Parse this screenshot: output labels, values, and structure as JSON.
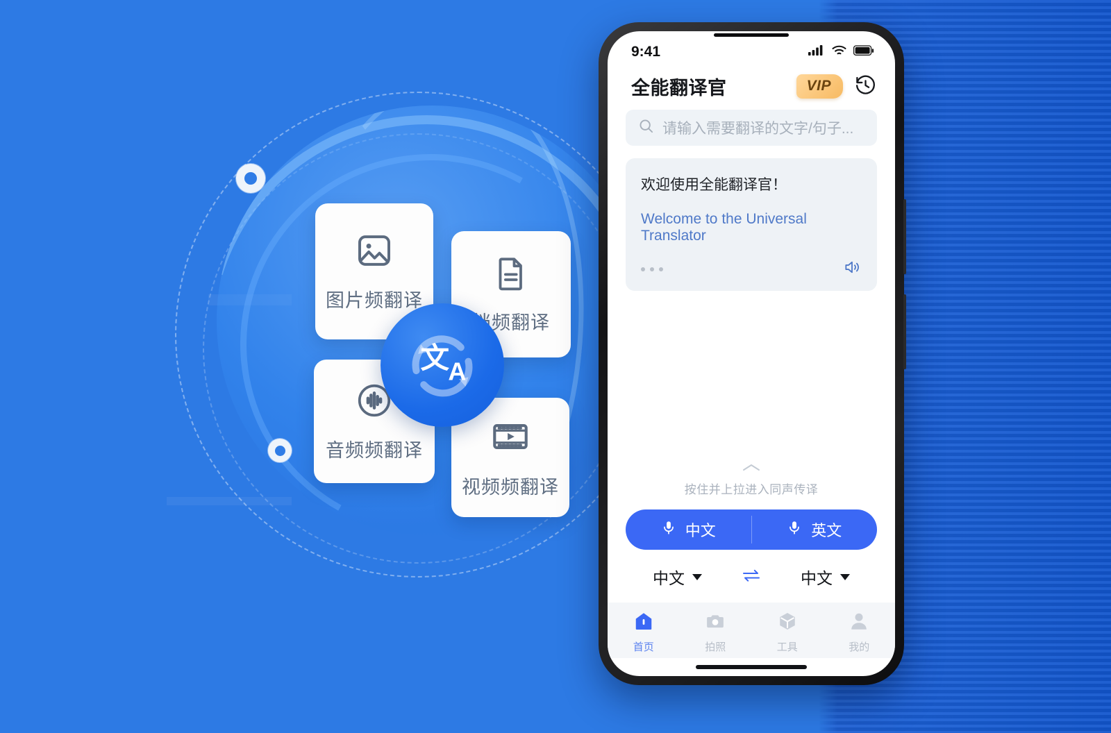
{
  "theme": {
    "background_blue": "#2d7ae4",
    "stripe_blue": "#1f63d8",
    "accent_blue": "#3b68f5",
    "logo_blue": "#1b6ae8",
    "vip_gold": "#f7ba62",
    "card_white": "#fdfdfd",
    "translate_link_blue": "#4f79c8"
  },
  "promo": {
    "cards": [
      {
        "label": "图片频翻译",
        "icon": "image-icon"
      },
      {
        "label": "档频翻译",
        "icon": "document-icon"
      },
      {
        "label": "音频频翻译",
        "icon": "audio-waveform-icon"
      },
      {
        "label": "视频频翻译",
        "icon": "video-film-icon"
      }
    ],
    "logo": {
      "icon": "translate-logo-icon",
      "glyphs": "文A"
    }
  },
  "phone": {
    "statusbar": {
      "time": "9:41",
      "icons": [
        "cellular-signal-icon",
        "wifi-icon",
        "battery-icon"
      ]
    },
    "header": {
      "title": "全能翻译官",
      "vip_label": "VIP",
      "history_icon": "history-clock-icon"
    },
    "search": {
      "icon": "search-icon",
      "placeholder": "请输入需要翻译的文字/句子..."
    },
    "translation_card": {
      "source_text": "欢迎使用全能翻译官！",
      "target_text": "Welcome to the Universal Translator",
      "more_icon": "more-dots-icon",
      "speaker_icon": "speaker-icon"
    },
    "pull_hint": {
      "chevron_icon": "chevron-up-icon",
      "text": "按住并上拉进入同声传译"
    },
    "mic_buttons": [
      {
        "label": "中文",
        "icon": "microphone-icon"
      },
      {
        "label": "英文",
        "icon": "microphone-icon"
      }
    ],
    "language_row": {
      "source": "中文",
      "target": "中文",
      "swap_icon": "swap-arrows-icon"
    },
    "tabs": [
      {
        "label": "首页",
        "icon": "home-icon",
        "active": true
      },
      {
        "label": "拍照",
        "icon": "camera-icon",
        "active": false
      },
      {
        "label": "工具",
        "icon": "toolbox-cube-icon",
        "active": false
      },
      {
        "label": "我的",
        "icon": "user-profile-icon",
        "active": false
      }
    ]
  }
}
